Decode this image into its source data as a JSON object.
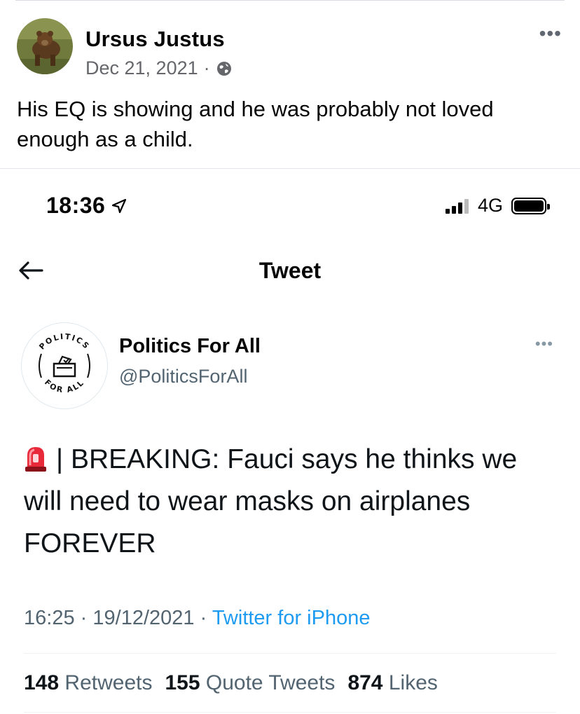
{
  "post": {
    "author": "Ursus Justus",
    "date": "Dec 21, 2021",
    "separator": "·",
    "privacy_icon": "globe-icon",
    "text": "His EQ is showing and he was probably not loved enough as a child.",
    "more_label": "•••"
  },
  "phone": {
    "time": "18:36",
    "network": "4G",
    "nav_title": "Tweet"
  },
  "tweet": {
    "display_name": "Politics For All",
    "handle": "@PoliticsForAll",
    "more_label": "•••",
    "avatar_logo_text_top": "POLITICS",
    "avatar_logo_text_bottom": "FOR ALL",
    "text": "| BREAKING: Fauci says he thinks we will need to wear masks on airplanes FOREVER",
    "time": "16:25",
    "date": "19/12/2021",
    "separator": "·",
    "source": "Twitter for iPhone",
    "retweets_count": "148",
    "retweets_label": "Retweets",
    "quotes_count": "155",
    "quotes_label": "Quote Tweets",
    "likes_count": "874",
    "likes_label": "Likes"
  },
  "colors": {
    "facebook_meta": "#65676b",
    "twitter_blue": "#1d9bf0",
    "twitter_gray": "#536471"
  }
}
